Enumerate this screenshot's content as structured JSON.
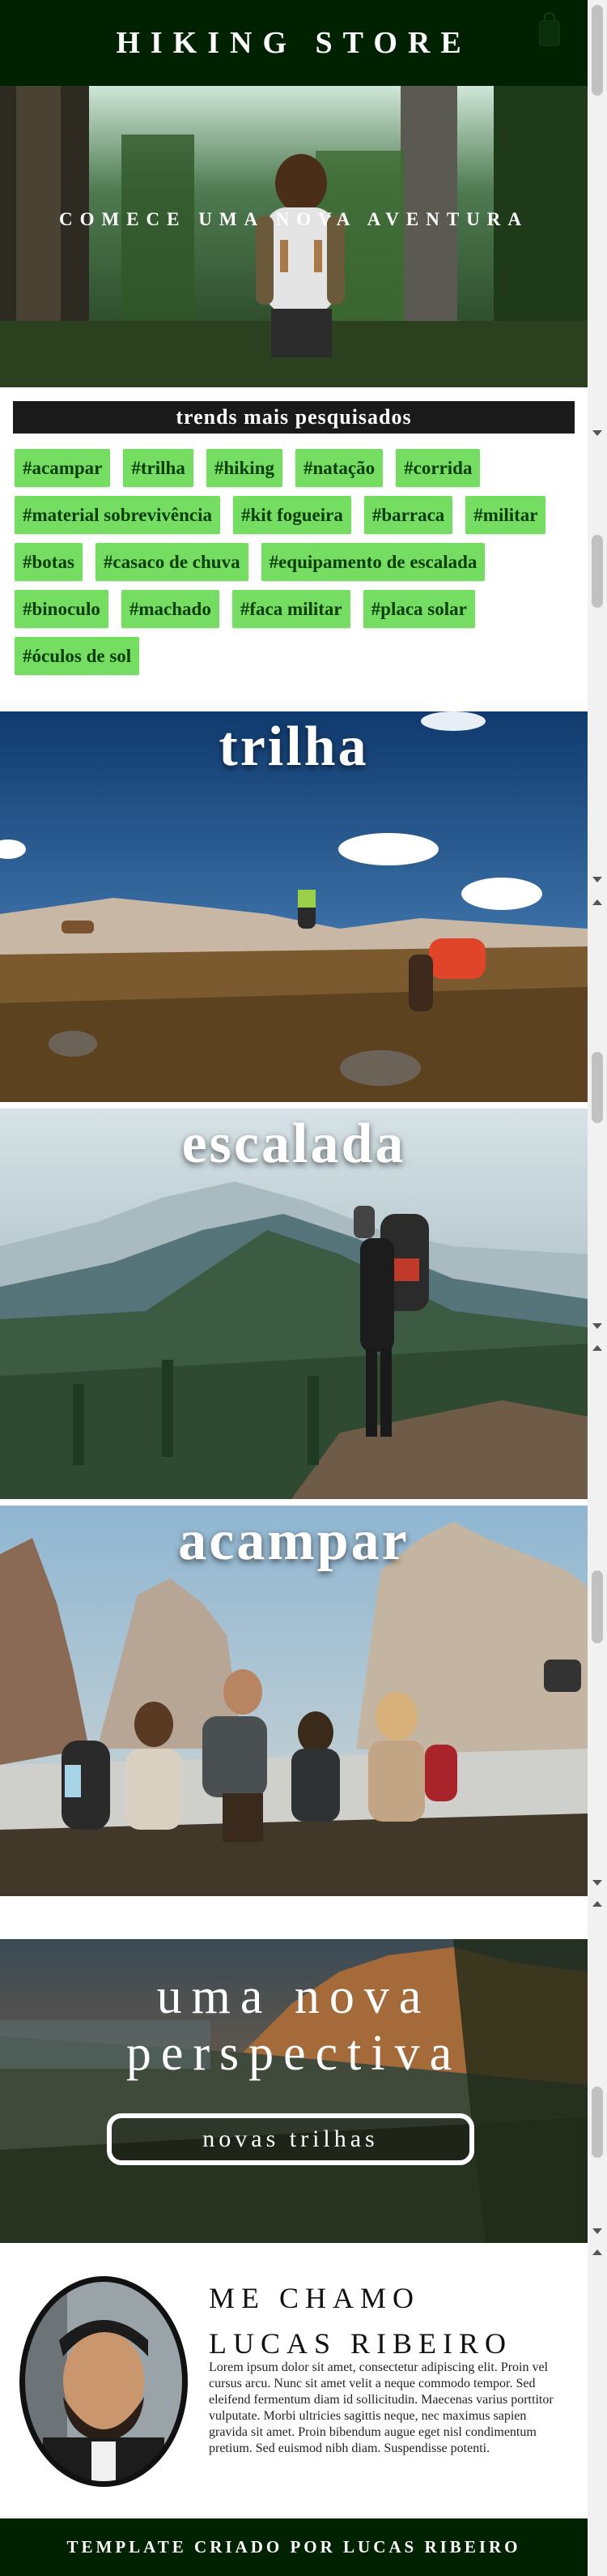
{
  "header": {
    "title": "HIKING STORE",
    "cart_icon": "shopping-bag-icon"
  },
  "hero": {
    "title": "COMECE UMA NOVA AVENTURA"
  },
  "trends": {
    "title": "trends mais pesquisados",
    "tags": [
      "#acampar",
      "#trilha",
      "#hiking",
      "#natação",
      "#corrida",
      "#material sobrevivência",
      "#kit fogueira",
      "#barraca",
      "#militar",
      "#botas",
      "#casaco de chuva",
      "#equipamento de escalada",
      "#binoculo",
      "#machado",
      "#faca militar",
      "#placa solar",
      "#óculos de sol"
    ]
  },
  "categories": [
    {
      "label": "trilha"
    },
    {
      "label": "escalada"
    },
    {
      "label": "acampar"
    }
  ],
  "perspective": {
    "line1": "uma nova",
    "line2": "perspectiva",
    "button": "novas trilhas"
  },
  "about": {
    "name_line1": "ME CHAMO",
    "name_line2": "LUCAS RIBEIRO",
    "text": "Lorem ipsum dolor sit amet, consectetur adipiscing elit. Proin vel cursus arcu. Nunc sit amet velit a neque commodo tempor. Sed eleifend fermentum diam id sollicitudin. Maecenas varius porttitor vulputate. Morbi ultricies sagittis neque, nec maximus sapien gravida sit amet. Proin bibendum augue eget nisl condimentum pretium. Sed euismod nibh diam. Suspendisse potenti."
  },
  "footer": {
    "text": "TEMPLATE CRIADO POR LUCAS RIBEIRO"
  },
  "colors": {
    "header_bg": "#002200",
    "tag_bg": "#74dd62",
    "tag_text": "#073d07",
    "trends_bg": "#1a1a1a"
  }
}
